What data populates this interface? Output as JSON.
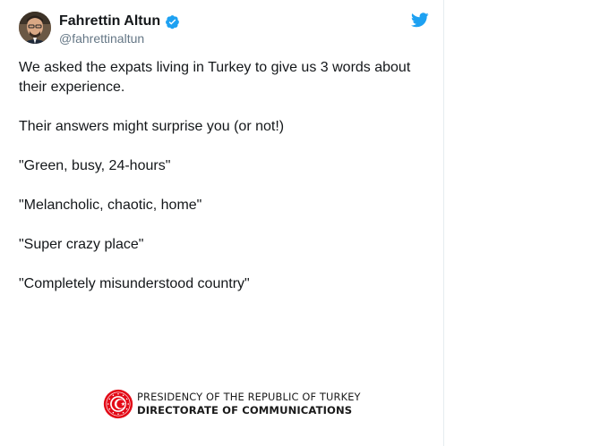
{
  "tweet": {
    "author": {
      "display_name": "Fahrettin Altun",
      "handle": "@fahrettinaltun",
      "verified": true,
      "avatar_icon": "profile-photo"
    },
    "platform_icon": "twitter-bird-icon",
    "paragraphs": [
      "We asked the expats living in Turkey to give us 3 words about their experience.",
      "Their answers might surprise you (or not!)",
      "\"Green, busy, 24-hours\"",
      "\"Melancholic, chaotic, home\"",
      "\"Super crazy place\"",
      "\"Completely misunderstood country\""
    ]
  },
  "footer": {
    "line_1": "PRESIDENCY OF THE REPUBLIC OF TURKEY",
    "line_2": "DIRECTORATE OF COMMUNICATIONS",
    "emblem_icon": "presidential-seal-icon"
  },
  "colors": {
    "text_primary": "#14171a",
    "text_secondary": "#657786",
    "twitter_blue": "#1da1f2",
    "emblem_red": "#e30a17"
  }
}
